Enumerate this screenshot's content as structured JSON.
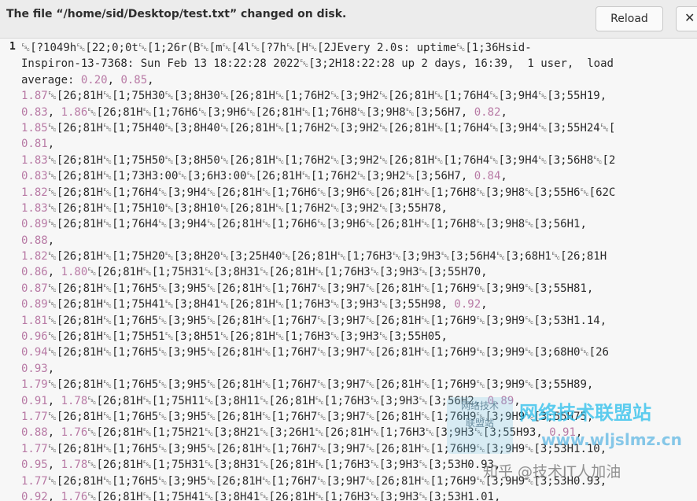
{
  "infobar": {
    "message": "The file “/home/sid/Desktop/test.txt” changed on disk.",
    "reload_label": "Reload",
    "close_icon": "close-icon"
  },
  "editor": {
    "line_number": "1",
    "lines": [
      "[?1049h[22;0;0t[1;26r(B[m[4l[?7h[H[2JEvery 2.0s: uptime[1;36Hsid-",
      "Inspiron-13-7368: Sun Feb 13 18:22:28 2022[3;2H18:22:28 up 2 days, 16:39,  1 user,  load",
      "average: 0.20, 0.85,",
      "1.87[26;81H[1;75H30[3;8H30[26;81H[1;76H2[3;9H2[26;81H[1;76H4[3;9H4[3;55H19,",
      "0.83, 1.86[26;81H[1;76H6[3;9H6[26;81H[1;76H8[3;9H8[3;56H7, 0.82,",
      "1.85[26;81H[1;75H40[3;8H40[26;81H[1;76H2[3;9H2[26;81H[1;76H4[3;9H4[3;55H24[",
      "0.81,",
      "1.83[26;81H[1;75H50[3;8H50[26;81H[1;76H2[3;9H2[26;81H[1;76H4[3;9H4[3;56H8[2",
      "0.83[26;81H[1;73H3:00[3;6H3:00[26;81H[1;76H2[3;9H2[3;56H7, 0.84,",
      "1.82[26;81H[1;76H4[3;9H4[26;81H[1;76H6[3;9H6[26;81H[1;76H8[3;9H8[3;55H6[62C",
      "1.83[26;81H[1;75H10[3;8H10[26;81H[1;76H2[3;9H2[3;55H78,",
      "0.89[26;81H[1;76H4[3;9H4[26;81H[1;76H6[3;9H6[26;81H[1;76H8[3;9H8[3;56H1,",
      "0.88,",
      "1.82[26;81H[1;75H20[3;8H20[3;25H40[26;81H[1;76H3[3;9H3[3;56H4[3;68H1[26;81H",
      "0.86, 1.80[26;81H[1;75H31[3;8H31[26;81H[1;76H3[3;9H3[3;55H70,",
      "0.87[26;81H[1;76H5[3;9H5[26;81H[1;76H7[3;9H7[26;81H[1;76H9[3;9H9[3;55H81,",
      "0.89[26;81H[1;75H41[3;8H41[26;81H[1;76H3[3;9H3[3;55H98, 0.92,",
      "1.81[26;81H[1;76H5[3;9H5[26;81H[1;76H7[3;9H7[26;81H[1;76H9[3;9H9[3;53H1.14,",
      "0.96[26;81H[1;75H51[3;8H51[26;81H[1;76H3[3;9H3[3;55H05,",
      "0.94[26;81H[1;76H5[3;9H5[26;81H[1;76H7[3;9H7[26;81H[1;76H9[3;9H9[3;68H0[26",
      "0.93,",
      "1.79[26;81H[1;76H5[3;9H5[26;81H[1;76H7[3;9H7[26;81H[1;76H9[3;9H9[3;55H89,",
      "0.91, 1.78[26;81H[1;75H11[3;8H11[26;81H[1;76H3[3;9H3[3;56H2, 0.89,",
      "1.77[26;81H[1;76H5[3;9H5[26;81H[1;76H7[3;9H7[26;81H[1;76H9[3;9H9[3;55H75,",
      "0.88, 1.76[26;81H[1;75H21[3;8H21[3;26H1[26;81H[1;76H3[3;9H3[3;55H93, 0.91,",
      "1.77[26;81H[1;76H5[3;9H5[26;81H[1;76H7[3;9H7[26;81H[1;76H9[3;9H9[3;53H1.10,",
      "0.95, 1.78[26;81H[1;75H31[3;8H31[26;81H[1;76H3[3;9H3[3;53H0.93,",
      "1.77[26;81H[1;76H5[3;9H5[26;81H[1;76H7[3;9H7[26;81H[1;76H9[3;9H9[3;53H0.93,",
      "0.92, 1.76[26;81H[1;75H41[3;8H41[26;81H[1;76H3[3;9H3[3;53H1.01,"
    ]
  },
  "watermark": {
    "logo_line1": "网络技术",
    "logo_line2": "联盟站",
    "title": "网络技术联盟站",
    "url": "www.wljslmz.cn",
    "sub": "知乎 @技术IT人加油"
  },
  "colors": {
    "number": "#b87aa5",
    "infobar": "#ececec"
  }
}
